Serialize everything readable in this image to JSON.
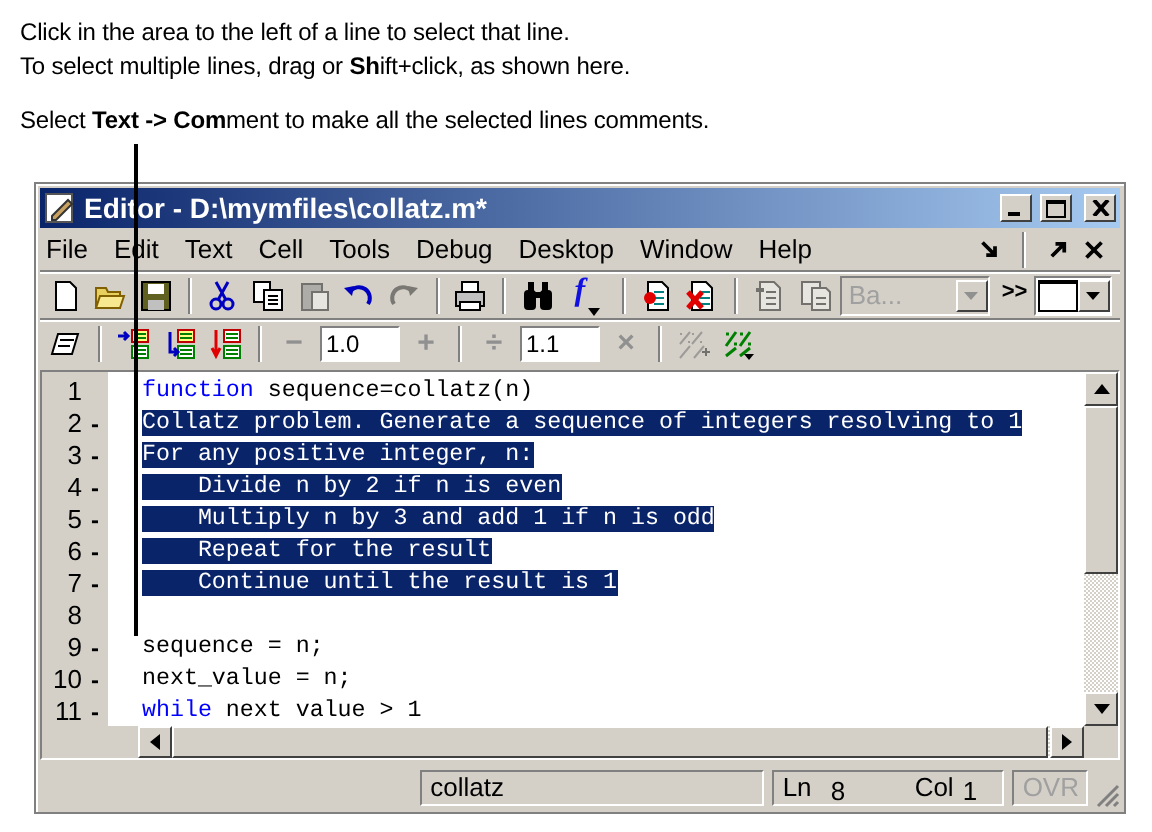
{
  "caption": [
    "Click in the area to the left of a line to select that line.",
    "To select multiple lines, drag or **Sh**ift+click, as shown here.",
    "Select **Text -> Com**ment to make all the selected lines comments."
  ],
  "window": {
    "title": "Editor - D:\\mymfiles\\collatz.m*"
  },
  "menu": [
    "File",
    "Edit",
    "Text",
    "Cell",
    "Tools",
    "Debug",
    "Desktop",
    "Window",
    "Help"
  ],
  "toolbar_1": [
    {
      "kind": "icon",
      "disabled": false
    },
    {
      "kind": "icon",
      "disabled": false
    },
    {
      "kind": "icon",
      "disabled": false
    },
    {
      "kind": "separator"
    },
    {
      "kind": "icon",
      "disabled": false
    },
    {
      "kind": "icon",
      "disabled": false
    },
    {
      "kind": "icon",
      "disabled": true
    },
    {
      "kind": "icon",
      "disabled": false
    },
    {
      "kind": "icon",
      "disabled": true
    },
    {
      "kind": "separator"
    },
    {
      "kind": "icon",
      "disabled": false
    },
    {
      "kind": "separator"
    },
    {
      "kind": "icon",
      "disabled": false
    },
    {
      "kind": "function",
      "label": "f",
      "disabled": false
    },
    {
      "kind": "separator"
    },
    {
      "kind": "icon",
      "disabled": false
    },
    {
      "kind": "icon",
      "disabled": false
    },
    {
      "kind": "separator"
    },
    {
      "kind": "icon",
      "disabled": true
    },
    {
      "kind": "icon",
      "disabled": true
    },
    {
      "kind": "dropdown",
      "value": "Ba...",
      "disabled": true
    }
  ],
  "toolbar_1_more": ">>",
  "toolbar_2": [
    {
      "kind": "icon",
      "disabled": false
    },
    {
      "kind": "separator"
    },
    {
      "kind": "icon",
      "disabled": false
    },
    {
      "kind": "icon",
      "disabled": false
    },
    {
      "kind": "icon",
      "disabled": false
    },
    {
      "kind": "separator"
    },
    {
      "kind": "text-button",
      "label": "−",
      "disabled": true
    },
    {
      "kind": "field",
      "value": "1.0"
    },
    {
      "kind": "text-button",
      "label": "+",
      "disabled": true
    },
    {
      "kind": "separator"
    },
    {
      "kind": "text-button",
      "label": "÷",
      "disabled": true
    },
    {
      "kind": "field",
      "value": "1.1"
    },
    {
      "kind": "text-button",
      "label": "×",
      "disabled": true
    },
    {
      "kind": "separator"
    },
    {
      "kind": "icon",
      "disabled": true
    },
    {
      "kind": "icon",
      "disabled": false
    }
  ],
  "code_lines": [
    {
      "number": "1",
      "selected": false,
      "tokens": [
        {
          "kind": "keyword",
          "text": "function"
        },
        {
          "kind": "plain",
          "text": " sequence=collatz(n)"
        }
      ]
    },
    {
      "number": "2",
      "marker": "-",
      "selected": true,
      "tokens": [
        {
          "kind": "plain",
          "text": "Collatz problem. Generate a sequence of integers resolving to 1"
        }
      ]
    },
    {
      "number": "3",
      "marker": "-",
      "selected": true,
      "tokens": [
        {
          "kind": "plain",
          "text": "For any positive integer, n:"
        }
      ]
    },
    {
      "number": "4",
      "marker": "-",
      "selected": true,
      "tokens": [
        {
          "kind": "plain",
          "text": "    Divide n by 2 if n is even"
        }
      ]
    },
    {
      "number": "5",
      "marker": "-",
      "selected": true,
      "tokens": [
        {
          "kind": "plain",
          "text": "    Multiply n by 3 and add 1 if n is odd"
        }
      ]
    },
    {
      "number": "6",
      "marker": "-",
      "selected": true,
      "tokens": [
        {
          "kind": "plain",
          "text": "    Repeat for the result"
        }
      ]
    },
    {
      "number": "7",
      "marker": "-",
      "selected": true,
      "tokens": [
        {
          "kind": "plain",
          "text": "    Continue until the result is 1"
        }
      ]
    },
    {
      "number": "8"
    },
    {
      "number": "9",
      "marker": "-",
      "selected": false,
      "tokens": [
        {
          "kind": "plain",
          "text": "sequence = n;"
        }
      ]
    },
    {
      "number": "10",
      "marker": "-",
      "selected": false,
      "tokens": [
        {
          "kind": "plain",
          "text": "next_value = n;"
        }
      ]
    },
    {
      "number": "11",
      "marker": "-",
      "selected": false,
      "tokens": [
        {
          "kind": "keyword",
          "text": "while"
        },
        {
          "kind": "plain",
          "text": " next value > 1"
        }
      ]
    }
  ],
  "status_bar": {
    "file": "collatz",
    "ln_label": "Ln",
    "ln": "8",
    "col_label": "Col",
    "col": "1",
    "ovr": {
      "label": "OVR",
      "disabled": true
    }
  }
}
